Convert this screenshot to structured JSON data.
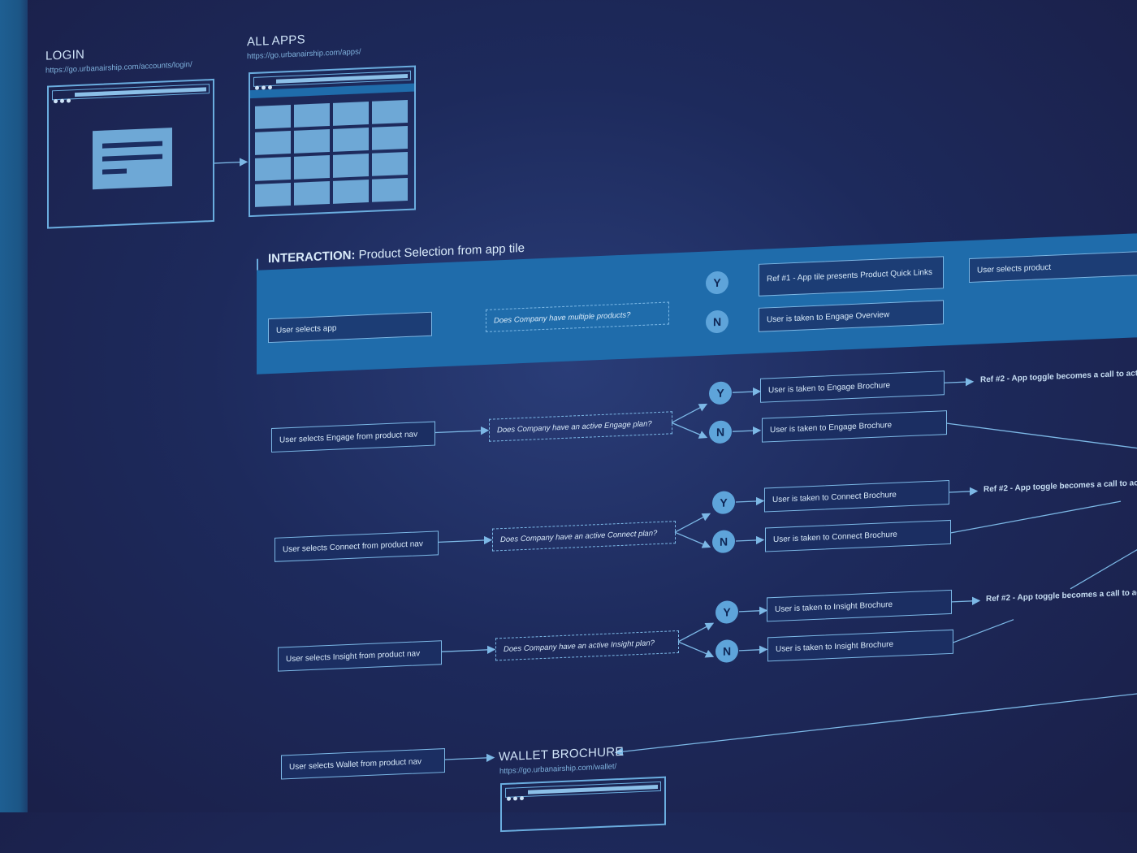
{
  "screens": {
    "login": {
      "title": "LOGIN",
      "url": "https://go.urbanairship.com/accounts/login/"
    },
    "all_apps": {
      "title": "ALL APPS",
      "url": "https://go.urbanairship.com/apps/"
    },
    "wallet": {
      "title": "WALLET BROCHURE",
      "url": "https://go.urbanairship.com/wallet/"
    }
  },
  "interaction": {
    "title_bold": "INTERACTION:",
    "title_rest": " Product Selection from app tile"
  },
  "flows": [
    {
      "start": "User selects app",
      "question": "Does Company have multiple products?",
      "yes": "Ref #1 - App tile presents Product Quick Links",
      "no": "User is taken to Engage Overview",
      "side": "User selects product"
    },
    {
      "start": "User selects Engage from product nav",
      "question": "Does Company have an active Engage plan?",
      "yes": "User is taken to Engage Brochure",
      "no": "User is taken to Engage Brochure",
      "ref": "Ref #2 - App toggle becomes a call to acti"
    },
    {
      "start": "User selects Connect from product nav",
      "question": "Does Company have an active Connect plan?",
      "yes": "User is taken to Connect Brochure",
      "no": "User is taken to Connect Brochure",
      "ref": "Ref #2 - App toggle becomes a call to act"
    },
    {
      "start": "User selects Insight from product nav",
      "question": "Does Company have an active Insight plan?",
      "yes": "User is taken to Insight Brochure",
      "no": "User is taken to Insight Brochure",
      "ref": "Ref #2 - App toggle becomes a call to ac"
    },
    {
      "start": "User selects Wallet from product nav"
    }
  ],
  "labels": {
    "yes": "Y",
    "no": "N"
  },
  "colors": {
    "background": "#1d2a5c",
    "band": "#1f6cab",
    "stroke": "#7cb8e6",
    "circle": "#5ea4da"
  }
}
